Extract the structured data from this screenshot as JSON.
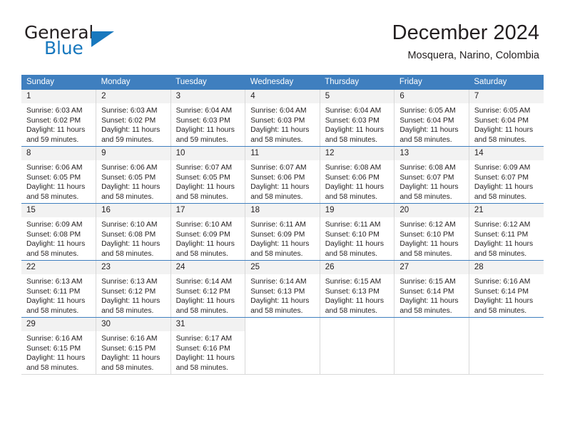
{
  "brand": {
    "name_part1": "General",
    "name_part2": "Blue",
    "accent_color": "#1878be"
  },
  "header": {
    "title": "December 2024",
    "subtitle": "Mosquera, Narino, Colombia"
  },
  "calendar": {
    "header_color": "#3f7fbf",
    "weekdays": [
      "Sunday",
      "Monday",
      "Tuesday",
      "Wednesday",
      "Thursday",
      "Friday",
      "Saturday"
    ],
    "weeks": [
      [
        {
          "day": "1",
          "sunrise": "Sunrise: 6:03 AM",
          "sunset": "Sunset: 6:02 PM",
          "daylight1": "Daylight: 11 hours",
          "daylight2": "and 59 minutes."
        },
        {
          "day": "2",
          "sunrise": "Sunrise: 6:03 AM",
          "sunset": "Sunset: 6:02 PM",
          "daylight1": "Daylight: 11 hours",
          "daylight2": "and 59 minutes."
        },
        {
          "day": "3",
          "sunrise": "Sunrise: 6:04 AM",
          "sunset": "Sunset: 6:03 PM",
          "daylight1": "Daylight: 11 hours",
          "daylight2": "and 59 minutes."
        },
        {
          "day": "4",
          "sunrise": "Sunrise: 6:04 AM",
          "sunset": "Sunset: 6:03 PM",
          "daylight1": "Daylight: 11 hours",
          "daylight2": "and 58 minutes."
        },
        {
          "day": "5",
          "sunrise": "Sunrise: 6:04 AM",
          "sunset": "Sunset: 6:03 PM",
          "daylight1": "Daylight: 11 hours",
          "daylight2": "and 58 minutes."
        },
        {
          "day": "6",
          "sunrise": "Sunrise: 6:05 AM",
          "sunset": "Sunset: 6:04 PM",
          "daylight1": "Daylight: 11 hours",
          "daylight2": "and 58 minutes."
        },
        {
          "day": "7",
          "sunrise": "Sunrise: 6:05 AM",
          "sunset": "Sunset: 6:04 PM",
          "daylight1": "Daylight: 11 hours",
          "daylight2": "and 58 minutes."
        }
      ],
      [
        {
          "day": "8",
          "sunrise": "Sunrise: 6:06 AM",
          "sunset": "Sunset: 6:05 PM",
          "daylight1": "Daylight: 11 hours",
          "daylight2": "and 58 minutes."
        },
        {
          "day": "9",
          "sunrise": "Sunrise: 6:06 AM",
          "sunset": "Sunset: 6:05 PM",
          "daylight1": "Daylight: 11 hours",
          "daylight2": "and 58 minutes."
        },
        {
          "day": "10",
          "sunrise": "Sunrise: 6:07 AM",
          "sunset": "Sunset: 6:05 PM",
          "daylight1": "Daylight: 11 hours",
          "daylight2": "and 58 minutes."
        },
        {
          "day": "11",
          "sunrise": "Sunrise: 6:07 AM",
          "sunset": "Sunset: 6:06 PM",
          "daylight1": "Daylight: 11 hours",
          "daylight2": "and 58 minutes."
        },
        {
          "day": "12",
          "sunrise": "Sunrise: 6:08 AM",
          "sunset": "Sunset: 6:06 PM",
          "daylight1": "Daylight: 11 hours",
          "daylight2": "and 58 minutes."
        },
        {
          "day": "13",
          "sunrise": "Sunrise: 6:08 AM",
          "sunset": "Sunset: 6:07 PM",
          "daylight1": "Daylight: 11 hours",
          "daylight2": "and 58 minutes."
        },
        {
          "day": "14",
          "sunrise": "Sunrise: 6:09 AM",
          "sunset": "Sunset: 6:07 PM",
          "daylight1": "Daylight: 11 hours",
          "daylight2": "and 58 minutes."
        }
      ],
      [
        {
          "day": "15",
          "sunrise": "Sunrise: 6:09 AM",
          "sunset": "Sunset: 6:08 PM",
          "daylight1": "Daylight: 11 hours",
          "daylight2": "and 58 minutes."
        },
        {
          "day": "16",
          "sunrise": "Sunrise: 6:10 AM",
          "sunset": "Sunset: 6:08 PM",
          "daylight1": "Daylight: 11 hours",
          "daylight2": "and 58 minutes."
        },
        {
          "day": "17",
          "sunrise": "Sunrise: 6:10 AM",
          "sunset": "Sunset: 6:09 PM",
          "daylight1": "Daylight: 11 hours",
          "daylight2": "and 58 minutes."
        },
        {
          "day": "18",
          "sunrise": "Sunrise: 6:11 AM",
          "sunset": "Sunset: 6:09 PM",
          "daylight1": "Daylight: 11 hours",
          "daylight2": "and 58 minutes."
        },
        {
          "day": "19",
          "sunrise": "Sunrise: 6:11 AM",
          "sunset": "Sunset: 6:10 PM",
          "daylight1": "Daylight: 11 hours",
          "daylight2": "and 58 minutes."
        },
        {
          "day": "20",
          "sunrise": "Sunrise: 6:12 AM",
          "sunset": "Sunset: 6:10 PM",
          "daylight1": "Daylight: 11 hours",
          "daylight2": "and 58 minutes."
        },
        {
          "day": "21",
          "sunrise": "Sunrise: 6:12 AM",
          "sunset": "Sunset: 6:11 PM",
          "daylight1": "Daylight: 11 hours",
          "daylight2": "and 58 minutes."
        }
      ],
      [
        {
          "day": "22",
          "sunrise": "Sunrise: 6:13 AM",
          "sunset": "Sunset: 6:11 PM",
          "daylight1": "Daylight: 11 hours",
          "daylight2": "and 58 minutes."
        },
        {
          "day": "23",
          "sunrise": "Sunrise: 6:13 AM",
          "sunset": "Sunset: 6:12 PM",
          "daylight1": "Daylight: 11 hours",
          "daylight2": "and 58 minutes."
        },
        {
          "day": "24",
          "sunrise": "Sunrise: 6:14 AM",
          "sunset": "Sunset: 6:12 PM",
          "daylight1": "Daylight: 11 hours",
          "daylight2": "and 58 minutes."
        },
        {
          "day": "25",
          "sunrise": "Sunrise: 6:14 AM",
          "sunset": "Sunset: 6:13 PM",
          "daylight1": "Daylight: 11 hours",
          "daylight2": "and 58 minutes."
        },
        {
          "day": "26",
          "sunrise": "Sunrise: 6:15 AM",
          "sunset": "Sunset: 6:13 PM",
          "daylight1": "Daylight: 11 hours",
          "daylight2": "and 58 minutes."
        },
        {
          "day": "27",
          "sunrise": "Sunrise: 6:15 AM",
          "sunset": "Sunset: 6:14 PM",
          "daylight1": "Daylight: 11 hours",
          "daylight2": "and 58 minutes."
        },
        {
          "day": "28",
          "sunrise": "Sunrise: 6:16 AM",
          "sunset": "Sunset: 6:14 PM",
          "daylight1": "Daylight: 11 hours",
          "daylight2": "and 58 minutes."
        }
      ],
      [
        {
          "day": "29",
          "sunrise": "Sunrise: 6:16 AM",
          "sunset": "Sunset: 6:15 PM",
          "daylight1": "Daylight: 11 hours",
          "daylight2": "and 58 minutes."
        },
        {
          "day": "30",
          "sunrise": "Sunrise: 6:16 AM",
          "sunset": "Sunset: 6:15 PM",
          "daylight1": "Daylight: 11 hours",
          "daylight2": "and 58 minutes."
        },
        {
          "day": "31",
          "sunrise": "Sunrise: 6:17 AM",
          "sunset": "Sunset: 6:16 PM",
          "daylight1": "Daylight: 11 hours",
          "daylight2": "and 58 minutes."
        },
        {
          "day": "",
          "sunrise": "",
          "sunset": "",
          "daylight1": "",
          "daylight2": ""
        },
        {
          "day": "",
          "sunrise": "",
          "sunset": "",
          "daylight1": "",
          "daylight2": ""
        },
        {
          "day": "",
          "sunrise": "",
          "sunset": "",
          "daylight1": "",
          "daylight2": ""
        },
        {
          "day": "",
          "sunrise": "",
          "sunset": "",
          "daylight1": "",
          "daylight2": ""
        }
      ]
    ]
  }
}
